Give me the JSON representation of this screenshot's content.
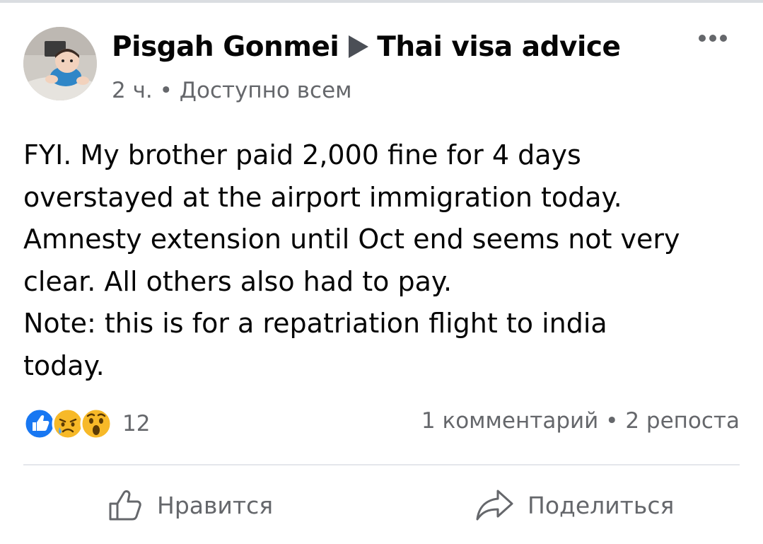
{
  "post": {
    "author": "Pisgah Gonmei",
    "group": "Thai visa advice",
    "time": "2 ч.",
    "meta_separator": "•",
    "audience": "Доступно всем",
    "text": "FYI. My brother paid 2,000 fine for 4 days\noverstayed at the airport immigration today.\nAmnesty extension until Oct end seems not very\nclear. All others also had to pay.\nNote: this is for a repatriation flight to india\ntoday."
  },
  "reactions": {
    "icons": [
      "like-icon",
      "sad-icon",
      "wow-icon"
    ],
    "count": "12"
  },
  "stats": {
    "comments": "1 комментарий",
    "separator": "•",
    "shares": "2 репоста"
  },
  "actions": {
    "like_label": "Нравится",
    "share_label": "Поделиться"
  },
  "colors": {
    "like_blue": "#1877f2",
    "emoji_yellow": "#f7b928",
    "secondary_text": "#65676b"
  }
}
